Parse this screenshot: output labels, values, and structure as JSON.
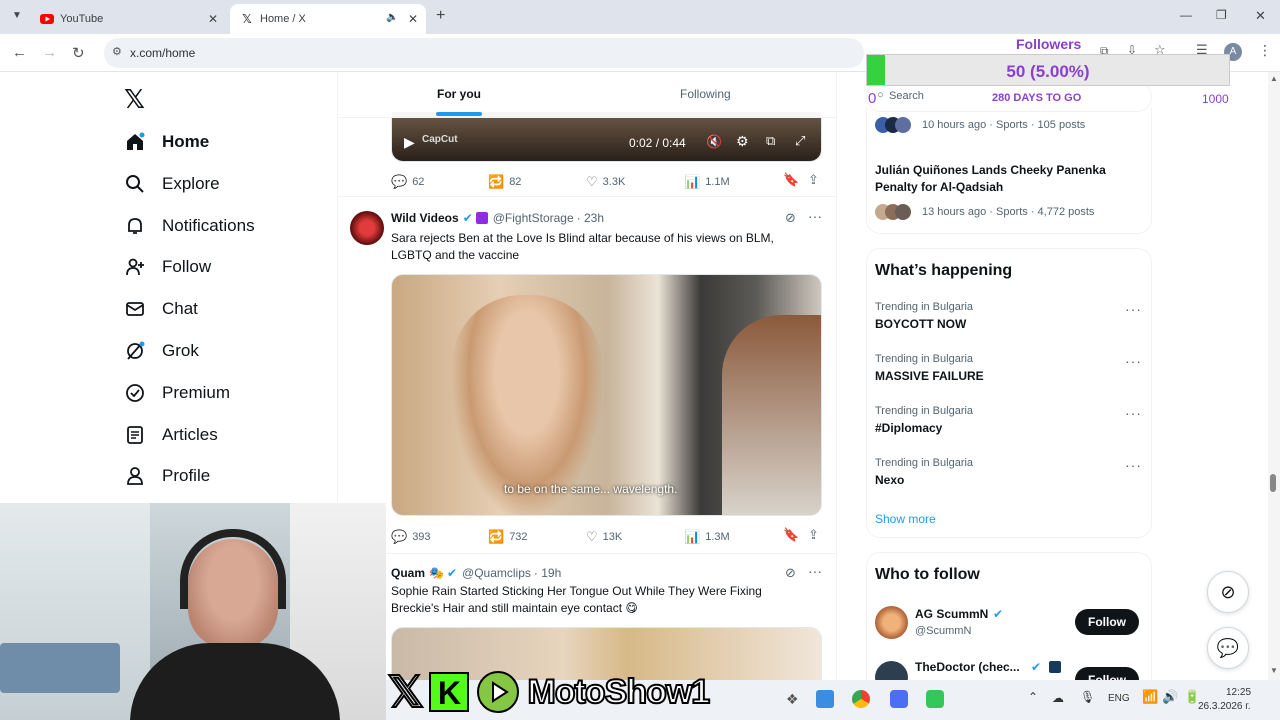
{
  "browser": {
    "tabs": [
      {
        "label": "YouTube",
        "icon": "youtube-icon"
      },
      {
        "label": "Home / X",
        "icon": "x-logo-icon"
      }
    ],
    "url": "x.com/home"
  },
  "overlay": {
    "title": "Followers",
    "count": "50 (5.00%)",
    "progress": 0.05,
    "min": "0",
    "days": "280 DAYS TO GO",
    "max": "1000"
  },
  "nav": {
    "items": [
      {
        "label": "Home",
        "icon": "home-icon"
      },
      {
        "label": "Explore",
        "icon": "search-icon"
      },
      {
        "label": "Notifications",
        "icon": "bell-icon"
      },
      {
        "label": "Follow",
        "icon": "person-plus-icon"
      },
      {
        "label": "Chat",
        "icon": "mail-icon"
      },
      {
        "label": "Grok",
        "icon": "grok-icon"
      },
      {
        "label": "Premium",
        "icon": "verified-icon"
      },
      {
        "label": "Articles",
        "icon": "article-icon"
      },
      {
        "label": "Profile",
        "icon": "profile-icon"
      }
    ]
  },
  "timeline": {
    "tabs": [
      "For you",
      "Following"
    ],
    "video": {
      "time": "0:02 / 0:44",
      "watermark": "CapCut"
    },
    "tweet0_actions": {
      "replies": "62",
      "reposts": "82",
      "likes": "3.3K",
      "views": "1.1M"
    },
    "tweet1": {
      "name": "Wild Videos",
      "handle": "@FightStorage",
      "time": "· 23h",
      "text": "Sara rejects Ben at the Love Is Blind altar because of his views on BLM, LGBTQ and the vaccine",
      "caption": "to be on the same... wavelength.",
      "replies": "393",
      "reposts": "732",
      "likes": "13K",
      "views": "1.3M"
    },
    "tweet2": {
      "name": "Quam",
      "handle": "@Quamclips",
      "time": "· 19h",
      "text": "Sophie Rain Started Sticking Her Tongue Out While They Were Fixing Breckie's Hair and still maintain eye contact 😋"
    }
  },
  "right": {
    "search_placeholder": "Search",
    "news": [
      {
        "meta": "10 hours ago · Sports · 105 posts"
      },
      {
        "title": "Julián Quiñones Lands Cheeky Panenka Penalty for Al-Qadsiah",
        "meta": "13 hours ago · Sports · 4,772 posts"
      }
    ],
    "whats_happening": {
      "title": "What’s happening",
      "trends": [
        {
          "meta": "Trending in Bulgaria",
          "name": "BOYCOTT NOW"
        },
        {
          "meta": "Trending in Bulgaria",
          "name": "MASSIVE FAILURE"
        },
        {
          "meta": "Trending in Bulgaria",
          "name": "#Diplomacy"
        },
        {
          "meta": "Trending in Bulgaria",
          "name": "Nexo"
        }
      ],
      "show_more": "Show more"
    },
    "who_to_follow": {
      "title": "Who to follow",
      "users": [
        {
          "name": "AG ScummN",
          "handle": "@ScummN",
          "button": "Follow"
        },
        {
          "name": "TheDoctor (chec...",
          "button": "Follow"
        }
      ]
    }
  },
  "stream": {
    "brand": "MotoShow1"
  },
  "taskbar": {
    "lang": "ENG",
    "time": "12:25",
    "date": "26.3.2026 г."
  },
  "colors": {
    "accent": "#1d9bf0",
    "overlay": "#8b3fd1",
    "progress": "#35d13f"
  }
}
